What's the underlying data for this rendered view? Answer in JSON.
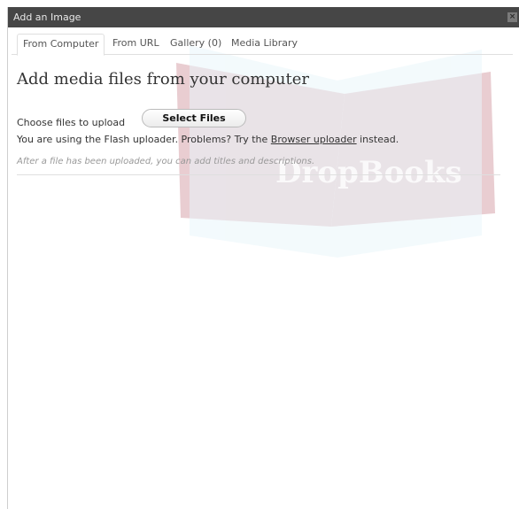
{
  "window": {
    "title": "Add an Image",
    "close_glyph": "×"
  },
  "tabs": [
    {
      "label": "From Computer",
      "active": true
    },
    {
      "label": "From URL",
      "active": false
    },
    {
      "label": "Gallery (0)",
      "active": false
    },
    {
      "label": "Media Library",
      "active": false
    }
  ],
  "main": {
    "heading": "Add media files from your computer",
    "choose_label": "Choose files to upload",
    "select_button": "Select Files",
    "flash_prefix": "You are using the Flash uploader. Problems? Try the",
    "browser_link": "Browser uploader",
    "flash_suffix": "instead.",
    "hint": "After a file has been uploaded, you can add titles and descriptions."
  },
  "watermark": {
    "text": "DropBooks"
  }
}
